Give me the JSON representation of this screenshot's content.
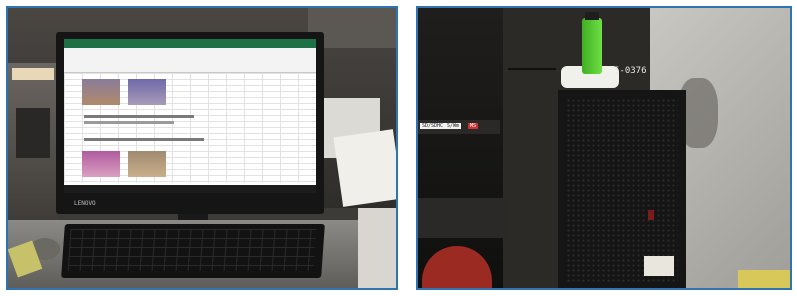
{
  "photos": [
    {
      "monitor_brand": "LENOVO",
      "description_hidden": true
    },
    {
      "sticker_code": "5-0376",
      "label_1": "SD/SDHC",
      "label_2": "S/Wm",
      "label_3": "MS"
    }
  ],
  "colors": {
    "frame_border": "#2e74b5",
    "excel_green": "#1e7145",
    "usb_green": "#5fcf3a"
  }
}
